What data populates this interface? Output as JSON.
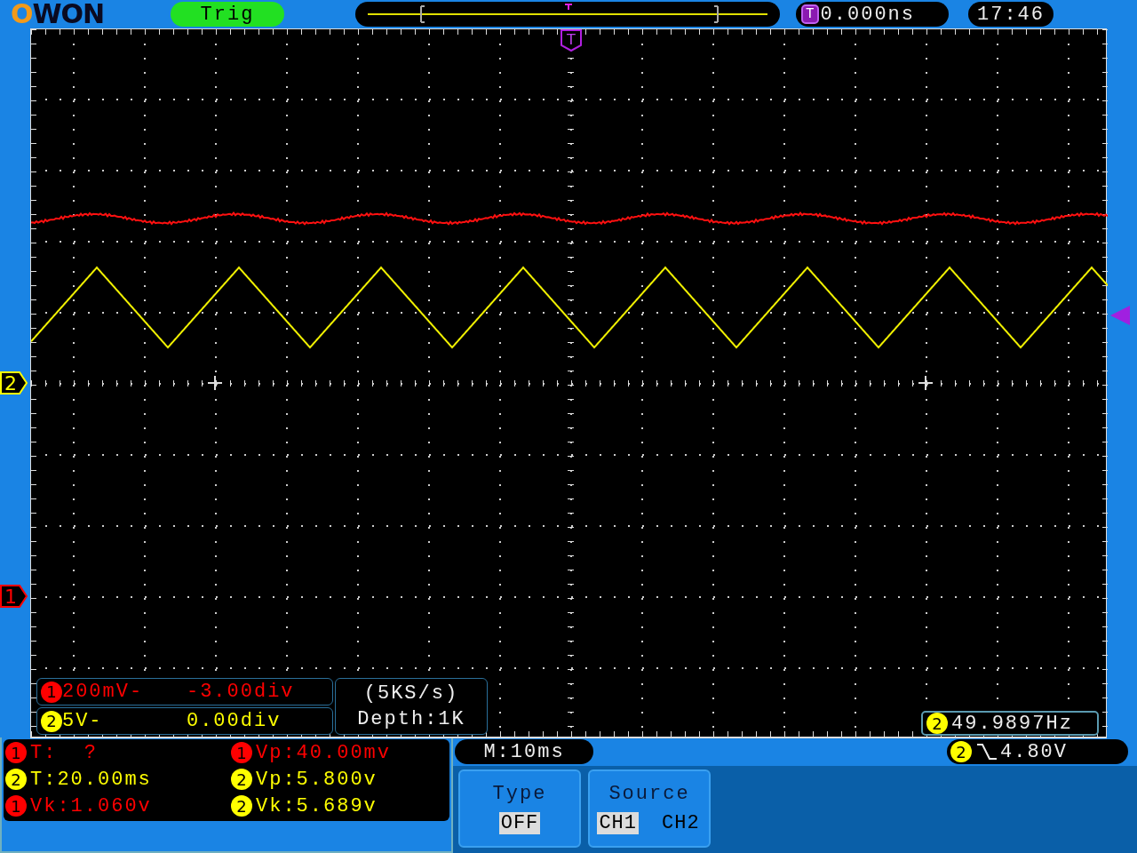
{
  "logo": "OWON",
  "trigger_status": "Trig",
  "trigger_time": {
    "icon": "T",
    "value": "0.000ns"
  },
  "clock": "17:46",
  "trigger_marker": "T",
  "channel_markers": [
    {
      "label": "2",
      "color": "#ffff00"
    },
    {
      "label": "1",
      "color": "#ff0000"
    }
  ],
  "channels": [
    {
      "badge": "1",
      "color": "#ff0000",
      "scale": "200mV-",
      "offset": "-3.00div"
    },
    {
      "badge": "2",
      "color": "#ffff00",
      "scale": "5V-",
      "offset": "0.00div"
    }
  ],
  "acquisition": {
    "rate": "(5KS/s)",
    "depth": "Depth:1K"
  },
  "frequency": {
    "badge": "2",
    "value": "49.9897Hz"
  },
  "measurements": [
    {
      "badge": "1",
      "color": "#ff0000",
      "text": "T:  ?"
    },
    {
      "badge": "1",
      "color": "#ff0000",
      "text": "Vp:40.00mv"
    },
    {
      "badge": "2",
      "color": "#ffff00",
      "text": "T:20.00ms"
    },
    {
      "badge": "2",
      "color": "#ffff00",
      "text": "Vp:5.800v"
    },
    {
      "badge": "1",
      "color": "#ff0000",
      "text": "Vk:1.060v"
    },
    {
      "badge": "2",
      "color": "#ffff00",
      "text": "Vk:5.689v"
    }
  ],
  "timebase": "M:10ms",
  "trigger": {
    "badge": "2",
    "value": "4.80V"
  },
  "menu": [
    {
      "title": "Type",
      "options": [
        {
          "label": "OFF",
          "selected": true
        }
      ]
    },
    {
      "title": "Source",
      "options": [
        {
          "label": "CH1",
          "selected": true
        },
        {
          "label": "CH2",
          "selected": false
        }
      ]
    }
  ]
}
